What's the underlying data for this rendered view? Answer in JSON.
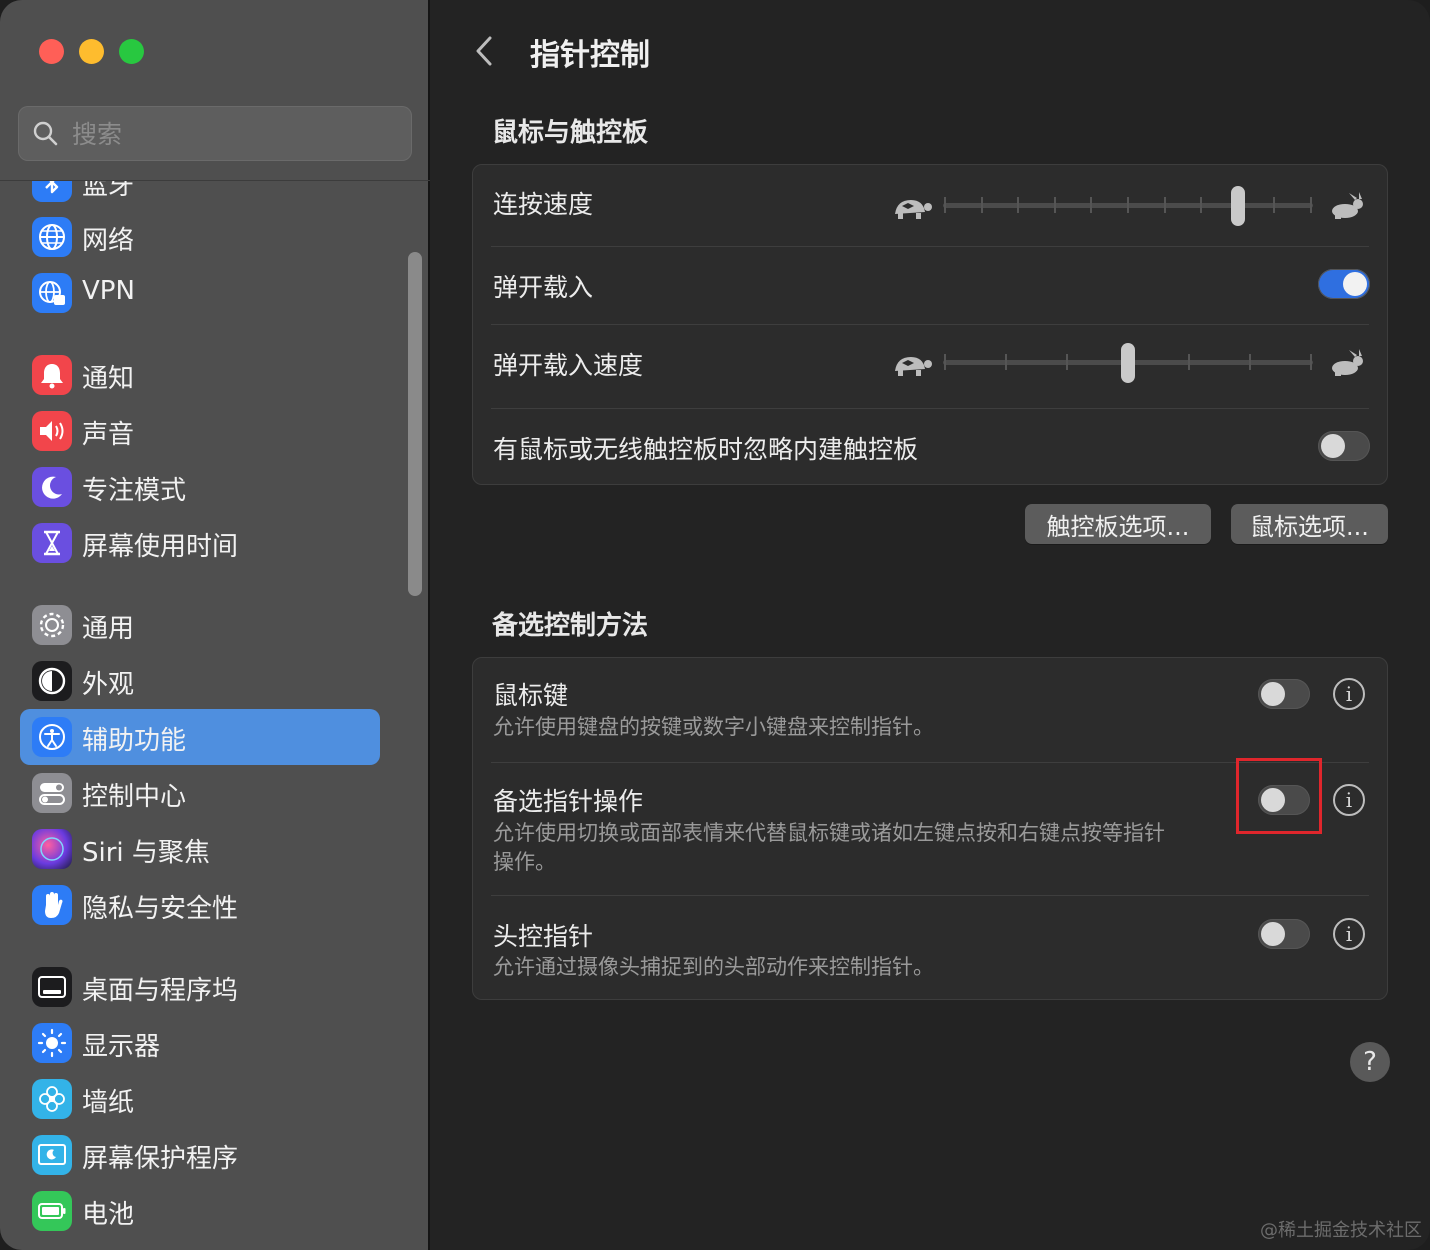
{
  "window": {
    "traffic_lights": [
      "close",
      "minimize",
      "zoom"
    ]
  },
  "sidebar": {
    "search_placeholder": "搜索",
    "items": [
      {
        "label": "蓝牙",
        "icon": "bluetooth-icon",
        "color": "#2d7cf6"
      },
      {
        "label": "网络",
        "icon": "globe-icon",
        "color": "#2d7cf6"
      },
      {
        "label": "VPN",
        "icon": "vpn-globe-icon",
        "color": "#2d7cf6"
      },
      {
        "label": "通知",
        "icon": "bell-icon",
        "color": "#f2454b"
      },
      {
        "label": "声音",
        "icon": "speaker-icon",
        "color": "#f2454b"
      },
      {
        "label": "专注模式",
        "icon": "moon-icon",
        "color": "#6a4fe0"
      },
      {
        "label": "屏幕使用时间",
        "icon": "hourglass-icon",
        "color": "#6a4fe0"
      },
      {
        "label": "通用",
        "icon": "gear-icon",
        "color": "#8e8e93"
      },
      {
        "label": "外观",
        "icon": "appearance-icon",
        "color": "#1c1c1e"
      },
      {
        "label": "辅助功能",
        "icon": "accessibility-icon",
        "color": "#2d7cf6"
      },
      {
        "label": "控制中心",
        "icon": "switches-icon",
        "color": "#8e8e93"
      },
      {
        "label": "Siri 与聚焦",
        "icon": "siri-icon",
        "color": "#7b3fd6"
      },
      {
        "label": "隐私与安全性",
        "icon": "hand-icon",
        "color": "#2d7cf6"
      },
      {
        "label": "桌面与程序坞",
        "icon": "dock-icon",
        "color": "#1c1c1e"
      },
      {
        "label": "显示器",
        "icon": "sun-icon",
        "color": "#2d7cf6"
      },
      {
        "label": "墙纸",
        "icon": "flower-icon",
        "color": "#33b3e8"
      },
      {
        "label": "屏幕保护程序",
        "icon": "screensaver-icon",
        "color": "#33b3e8"
      },
      {
        "label": "电池",
        "icon": "battery-icon",
        "color": "#34c759"
      }
    ],
    "active": "辅助功能"
  },
  "main": {
    "title": "指针控制",
    "section1": {
      "title": "鼠标与触控板",
      "rows": {
        "double_click": {
          "label": "连按速度",
          "ticks": 11,
          "value_index": 8
        },
        "spring_loading": {
          "label": "弹开载入",
          "on": true
        },
        "spring_speed": {
          "label": "弹开载入速度",
          "ticks": 7,
          "value_index": 3
        },
        "ignore_trackpad": {
          "label": "有鼠标或无线触控板时忽略内建触控板",
          "on": false
        }
      },
      "buttons": {
        "trackpad": "触控板选项...",
        "mouse": "鼠标选项..."
      }
    },
    "section2": {
      "title": "备选控制方法",
      "rows": {
        "mouse_keys": {
          "label": "鼠标键",
          "desc": "允许使用键盘的按键或数字小键盘来控制指针。",
          "on": false
        },
        "alt_pointer": {
          "label": "备选指针操作",
          "desc": "允许使用切换或面部表情来代替鼠标键或诸如左键点按和右键点按等指针操作。",
          "on": false
        },
        "head_pointer": {
          "label": "头控指针",
          "desc": "允许通过摄像头捕捉到的头部动作来控制指针。",
          "on": false
        }
      }
    },
    "help": "?"
  },
  "watermark": "@稀土掘金技术社区"
}
